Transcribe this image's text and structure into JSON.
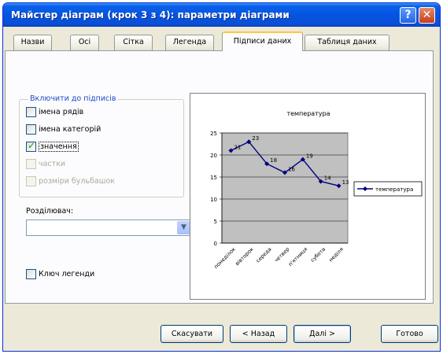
{
  "window": {
    "title": "Майстер діаграм (крок 3 з 4): параметри діаграми",
    "help_label": "?",
    "close_label": "✕"
  },
  "tabs": [
    {
      "label": "Назви",
      "active": false
    },
    {
      "label": "Осі",
      "active": false
    },
    {
      "label": "Сітка",
      "active": false
    },
    {
      "label": "Легенда",
      "active": false
    },
    {
      "label": "Підписи даних",
      "active": true
    },
    {
      "label": "Таблиця даних",
      "active": false
    }
  ],
  "include_group": {
    "title": "Включити до підписів",
    "options": [
      {
        "label": "імена рядів",
        "checked": false,
        "enabled": true
      },
      {
        "label": "імена категорій",
        "checked": false,
        "enabled": true
      },
      {
        "label": "значення",
        "checked": true,
        "enabled": true
      },
      {
        "label": "частки",
        "checked": false,
        "enabled": false
      },
      {
        "label": "розміри бульбашок",
        "checked": false,
        "enabled": false
      }
    ]
  },
  "separator": {
    "label": "Розділювач:",
    "value": ""
  },
  "legend_key": {
    "label": "Ключ легенди",
    "checked": false
  },
  "buttons": {
    "cancel": "Скасувати",
    "back": "< Назад",
    "next": "Далі >",
    "finish": "Готово"
  },
  "chart_data": {
    "type": "line",
    "title": "температура",
    "categories": [
      "понеділок",
      "вівторок",
      "середа",
      "четвер",
      "п'ятниця",
      "субота",
      "неділя"
    ],
    "series": [
      {
        "name": "температура",
        "values": [
          21,
          23,
          18,
          16,
          19,
          14,
          13
        ]
      }
    ],
    "data_labels": [
      "21",
      "23",
      "18",
      "16",
      "19",
      "14",
      "13"
    ],
    "ylim": [
      0,
      25
    ],
    "yticks": [
      "0",
      "5",
      "10",
      "15",
      "20",
      "25"
    ],
    "grid": true,
    "plot_bg": "#c0c0c0",
    "line_color": "#000080",
    "legend_position": "right"
  }
}
